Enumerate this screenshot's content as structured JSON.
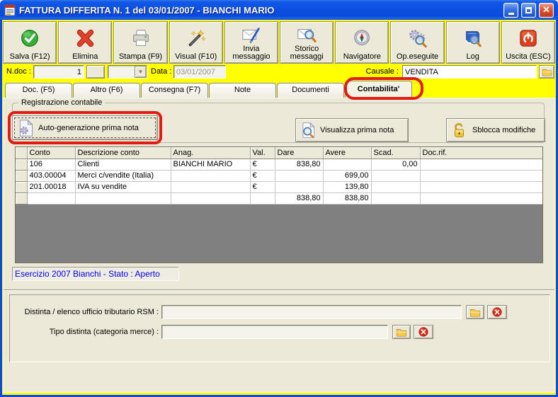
{
  "colors": {
    "annotation_red": "#E21B10",
    "client_yellow": "#FFFF00",
    "titlebar_blue": "#0A4ADC",
    "status_text_blue": "#0000E8"
  },
  "window": {
    "title": "FATTURA DIFFERITA N. 1  del 03/01/2007 - BIANCHI MARIO"
  },
  "toolbar": {
    "buttons": [
      {
        "label": "Salva (F12)"
      },
      {
        "label": "Elimina"
      },
      {
        "label": "Stampa (F9)"
      },
      {
        "label": "Visual (F10)"
      },
      {
        "label": "Invia messaggio"
      },
      {
        "label": "Storico messaggi"
      },
      {
        "label": "Navigatore"
      },
      {
        "label": "Op.eseguite"
      },
      {
        "label": "Log"
      },
      {
        "label": "Uscita (ESC)"
      }
    ]
  },
  "fields": {
    "ndoc_label": "N.doc :",
    "ndoc_value": "1",
    "combo_value": "",
    "data_label": "Data :",
    "data_value": "03/01/2007",
    "causale_label": "Causale :",
    "causale_value": "VENDITA"
  },
  "tabs": [
    {
      "label": "Doc. (F5)"
    },
    {
      "label": "Altro (F6)"
    },
    {
      "label": "Consegna (F7)"
    },
    {
      "label": "Note"
    },
    {
      "label": "Documenti"
    },
    {
      "label": "Contabilita'"
    }
  ],
  "contabilita": {
    "group_title": "Registrazione contabile",
    "autogen_button": "Auto-generazione prima nota",
    "visualizza_button": "Visualizza prima nota",
    "sblocca_button": "Sblocca modifiche",
    "table": {
      "columns": [
        "",
        "Conto",
        "Descrizione conto",
        "Anag.",
        "Val.",
        "Dare",
        "Avere",
        "Scad.",
        "Doc.rif."
      ],
      "rows": [
        [
          "106",
          "Clienti",
          "BIANCHI MARIO",
          "€",
          "838,80",
          "",
          "0,00",
          ""
        ],
        [
          "403.00004",
          "Merci c/vendite (Italia)",
          "",
          "€",
          "",
          "699,00",
          "",
          ""
        ],
        [
          "201.00018",
          "IVA su vendite",
          "",
          "€",
          "",
          "139,80",
          "",
          ""
        ],
        [
          "",
          "",
          "",
          "",
          "838,80",
          "838,80",
          "",
          ""
        ]
      ]
    },
    "status_text": "Esercizio 2007 Bianchi - Stato : Aperto"
  },
  "bottom": {
    "distinta_label": "Distinta / elenco ufficio tributario RSM :",
    "distinta_value": "",
    "tipo_label": "Tipo distinta (categoria merce) :",
    "tipo_value": ""
  }
}
